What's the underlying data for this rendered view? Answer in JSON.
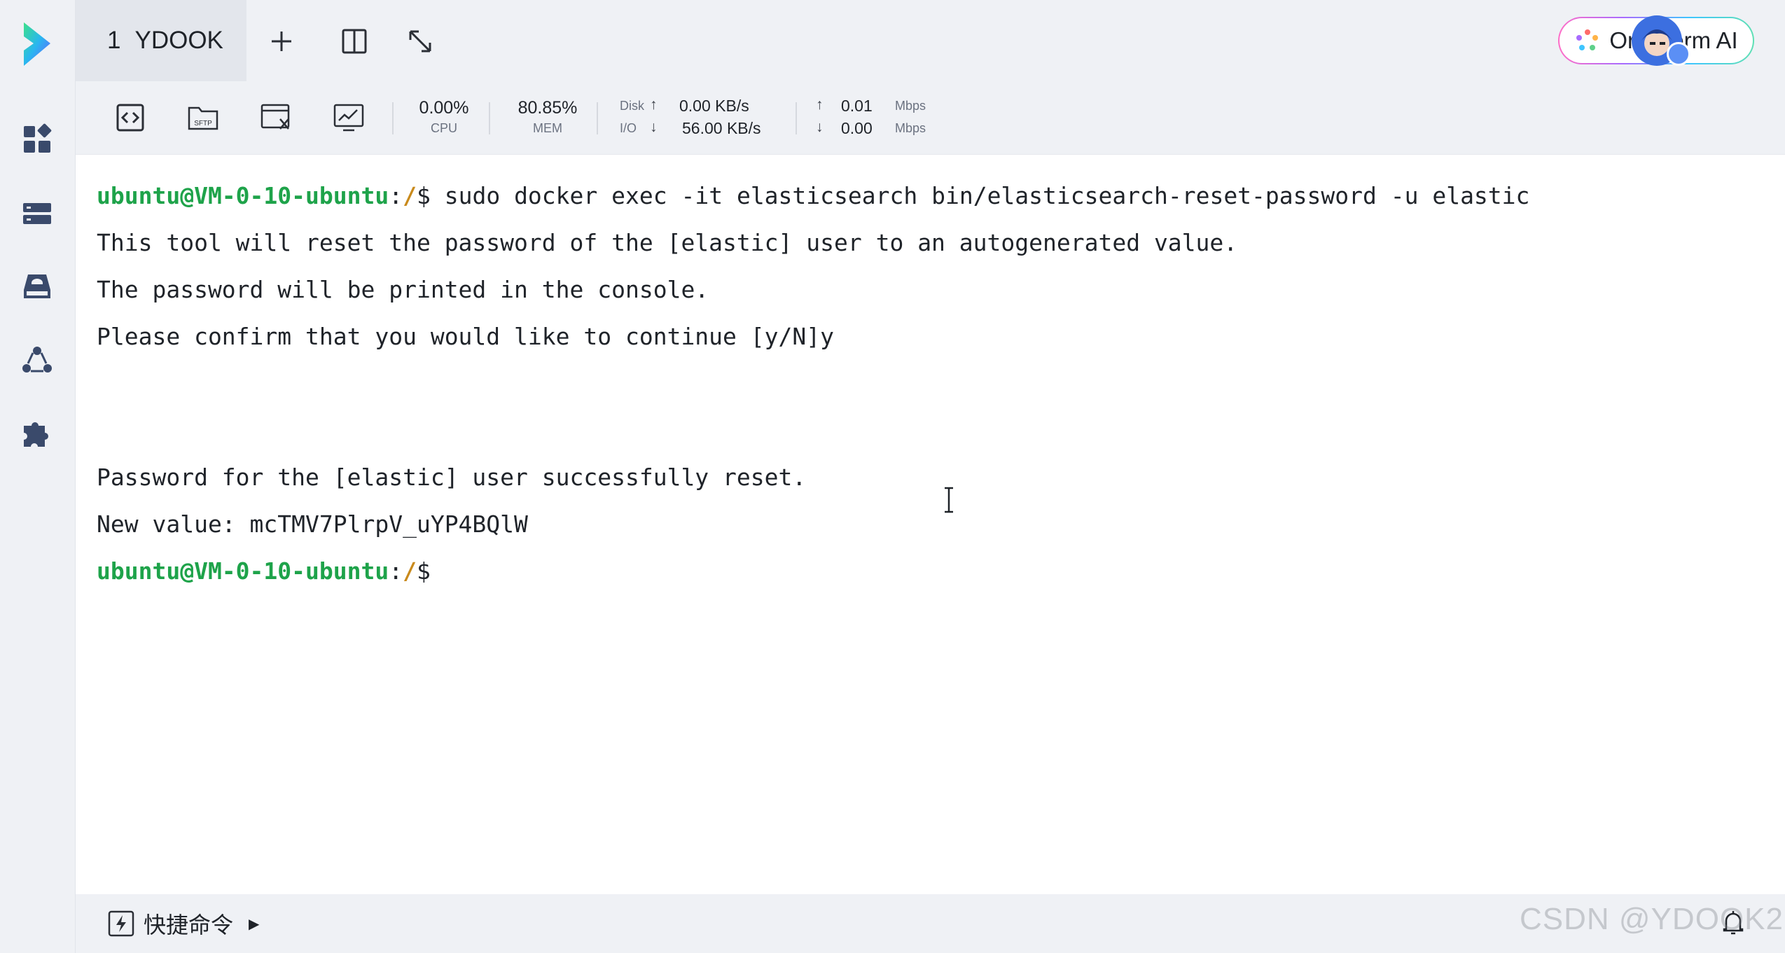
{
  "sidebar": {
    "items": [
      {
        "icon": "dashboard-icon"
      },
      {
        "icon": "server-list-icon"
      },
      {
        "icon": "storage-icon"
      },
      {
        "icon": "network-icon"
      },
      {
        "icon": "plugin-icon"
      }
    ]
  },
  "header": {
    "tab": {
      "number": "1",
      "label": "YDOOK"
    },
    "ai_button_label": "OrcaTerm AI"
  },
  "monitor": {
    "cpu": {
      "value": "0.00%",
      "label": "CPU"
    },
    "mem": {
      "value": "80.85%",
      "label": "MEM"
    },
    "disk": {
      "label_top": "Disk",
      "label_bottom": "I/O",
      "read": "0.00 KB/s",
      "write": "56.00 KB/s"
    },
    "net": {
      "up": "0.01",
      "down": "0.00",
      "unit_up": "Mbps",
      "unit_down": "Mbps"
    }
  },
  "terminal": {
    "prompt_user": "ubuntu@VM-0-10-ubuntu",
    "prompt_colon": ":",
    "prompt_path": "/",
    "prompt_symbol": "$",
    "command": " sudo docker exec -it elasticsearch bin/elasticsearch-reset-password -u elastic",
    "lines": [
      "This tool will reset the password of the [elastic] user to an autogenerated value.",
      "The password will be printed in the console.",
      "Please confirm that you would like to continue [y/N]y",
      "Password for the [elastic] user successfully reset.",
      "New value: mcTMV7PlrpV_uYP4BQlW"
    ]
  },
  "footer": {
    "quick_commands_label": "快捷命令"
  },
  "watermark": "CSDN @YDOOK2",
  "colors": {
    "prompt_user": "#1ea34a",
    "prompt_path": "#c98a1c",
    "background": "#eff1f5"
  }
}
